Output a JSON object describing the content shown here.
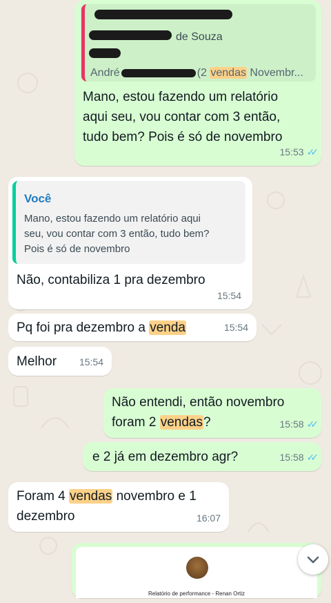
{
  "top_bubble": {
    "quote_line1": "de Souza",
    "quote_line2_prefix": "André",
    "quote_line2_part1": "(2 ",
    "quote_line2_highlight": "vendas",
    "quote_line2_part2": " Novembr...",
    "text_lines": [
      "Mano, estou fazendo um relatório",
      "aqui seu, vou contar com 3 então,",
      "tudo bem? Pois é só de novembro"
    ],
    "time": "15:53"
  },
  "reply_bubble": {
    "quote_author": "Você",
    "quote_lines": [
      "Mano, estou fazendo um relatório aqui",
      "seu, vou contar com 3 então, tudo bem?",
      "Pois é só de novembro"
    ],
    "text": "Não, contabiliza 1 pra dezembro",
    "time": "15:54"
  },
  "msg_pq": {
    "text_before": "Pq foi pra dezembro a ",
    "highlight": "venda",
    "time": "15:54"
  },
  "msg_melhor": {
    "text": "Melhor",
    "time": "15:54"
  },
  "msg_nao_entendi": {
    "line1": "Não entendi, então novembro",
    "line2_before": "foram 2 ",
    "line2_highlight": "vendas",
    "line2_after": "?",
    "time": "15:58"
  },
  "msg_e2": {
    "text": "e 2 já em dezembro agr?",
    "time": "15:58"
  },
  "msg_foram4": {
    "before": "Foram 4 ",
    "highlight": "vendas",
    "after": " novembro e 1",
    "line2": "dezembro",
    "time": "16:07"
  },
  "doc_preview": {
    "title": "Relatório de performance - Renan Ortiz"
  },
  "icons": {
    "read_receipt": "double-check-icon",
    "scroll_down": "chevron-down-icon"
  },
  "colors": {
    "outgoing": "#d9fdd3",
    "incoming": "#ffffff",
    "highlight": "#fcd188",
    "quote_bar": "#06cf9c",
    "read_tick": "#53bdeb"
  }
}
